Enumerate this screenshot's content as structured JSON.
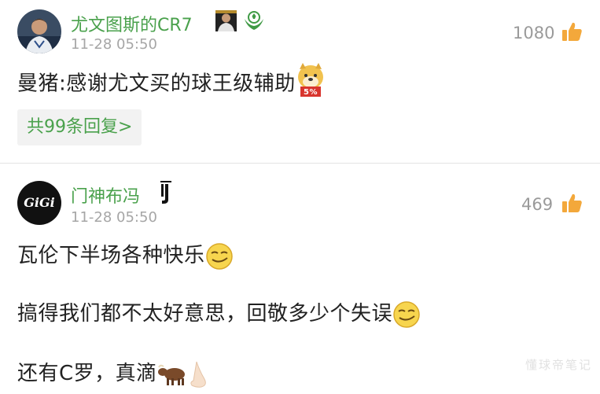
{
  "comments": [
    {
      "username": "尤文图斯的CR7",
      "time": "11-28 05:50",
      "likes": "1080",
      "lines": [
        "曼猪:感谢尤文买的球王级辅助"
      ],
      "replies_label": "共99条回复>",
      "badge_icons": [
        "player-photo-badge-icon",
        "football-hands-badge-icon"
      ],
      "emoji": "doge-5-percent-emoji",
      "emoji_badge_text": "5%"
    },
    {
      "username": "门神布冯",
      "avatar_text": "GiGi",
      "time": "11-28 05:50",
      "likes": "469",
      "badge_icons": [
        "juventus-logo-icon"
      ],
      "lines": [
        "瓦伦下半场各种快乐",
        "搞得我们都不太好意思，回敬多少个失误",
        "还有C罗，真滴"
      ],
      "emojis": [
        "smirk-emoji",
        "smirk-emoji",
        "bull-emoji",
        "nose-emoji"
      ]
    }
  ],
  "watermark": "懂球帝笔记",
  "colors": {
    "username": "#4aa14c",
    "meta": "#a6a6a6",
    "like_icon": "#f3a83b",
    "reply_bg": "#f2f2f2"
  }
}
